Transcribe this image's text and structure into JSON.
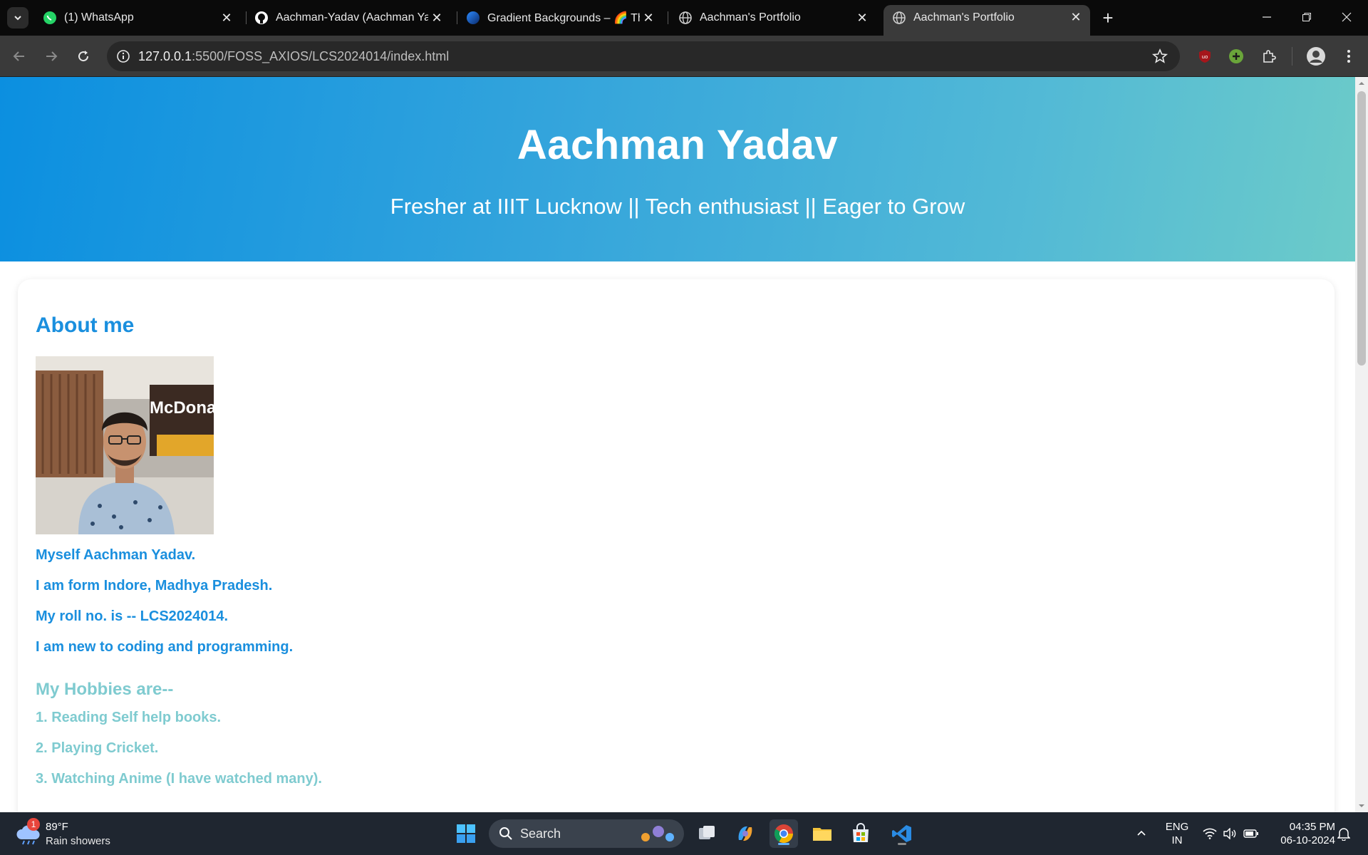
{
  "browser": {
    "tabs": [
      {
        "title": "(1) WhatsApp",
        "favicon": "whatsapp-icon",
        "active": false
      },
      {
        "title": "Aachman-Yadav (Aachman Yadav)",
        "favicon": "github-icon",
        "active": false
      },
      {
        "title": "Gradient Backgrounds – 🌈 The",
        "favicon": "gradient-globe-icon",
        "active": false
      },
      {
        "title": "Aachman's Portfolio",
        "favicon": "globe-icon",
        "active": false
      },
      {
        "title": "Aachman's Portfolio",
        "favicon": "globe-icon",
        "active": true
      }
    ],
    "url": {
      "host": "127.0.0.1",
      "rest": ":5500/FOSS_AXIOS/LCS2024014/index.html"
    }
  },
  "page": {
    "header": {
      "name": "Aachman Yadav",
      "tagline": "Fresher at IIIT Lucknow || Tech enthusiast || Eager to Grow"
    },
    "about": {
      "heading": "About me",
      "photo_text": "McDona",
      "lines": [
        "Myself Aachman Yadav.",
        "I am form Indore, Madhya Pradesh.",
        "My roll no. is -- LCS2024014.",
        "I am new to coding and programming."
      ],
      "hobbies_heading": "My Hobbies are--",
      "hobbies": [
        "1. Reading Self help books.",
        "2. Playing Cricket.",
        "3. Watching Anime (I have watched many)."
      ]
    },
    "colors": {
      "primary": "#1a8fde",
      "secondary": "#7fcbd0"
    }
  },
  "taskbar": {
    "weather": {
      "badge": "1",
      "temp": "89°F",
      "condition": "Rain showers"
    },
    "search_label": "Search",
    "lang": {
      "line1": "ENG",
      "line2": "IN"
    },
    "clock": {
      "time": "04:35 PM",
      "date": "06-10-2024"
    }
  }
}
